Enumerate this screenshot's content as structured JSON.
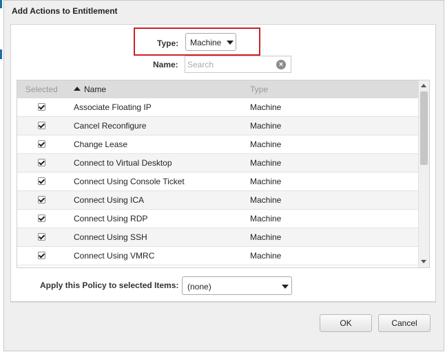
{
  "dialog": {
    "title": "Add Actions to Entitlement"
  },
  "filters": {
    "type_label": "Type:",
    "type_value": "Machine",
    "name_label": "Name:",
    "search_placeholder": "Search"
  },
  "grid": {
    "columns": [
      "Selected",
      "Name",
      "Type"
    ],
    "sorted_column": "Name",
    "sort_direction": "ascending",
    "rows": [
      {
        "selected": true,
        "name": "Associate Floating IP",
        "type": "Machine"
      },
      {
        "selected": true,
        "name": "Cancel Reconfigure",
        "type": "Machine"
      },
      {
        "selected": true,
        "name": "Change Lease",
        "type": "Machine"
      },
      {
        "selected": true,
        "name": "Connect to Virtual Desktop",
        "type": "Machine"
      },
      {
        "selected": true,
        "name": "Connect Using Console Ticket",
        "type": "Machine"
      },
      {
        "selected": true,
        "name": "Connect Using ICA",
        "type": "Machine"
      },
      {
        "selected": true,
        "name": "Connect Using RDP",
        "type": "Machine"
      },
      {
        "selected": true,
        "name": "Connect Using SSH",
        "type": "Machine"
      },
      {
        "selected": true,
        "name": "Connect Using VMRC",
        "type": "Machine"
      }
    ]
  },
  "policy": {
    "label": "Apply this Policy to selected Items:",
    "value": "(none)"
  },
  "buttons": {
    "ok": "OK",
    "cancel": "Cancel"
  },
  "colors": {
    "highlight": "#cc2222",
    "header_bg": "#dcdcdc",
    "dialog_bg": "#efefef"
  },
  "icons": [
    "dropdown-caret-icon",
    "clear-search-icon",
    "sort-ascending-icon",
    "checkbox-checked-icon",
    "scroll-up-icon",
    "scroll-down-icon"
  ]
}
